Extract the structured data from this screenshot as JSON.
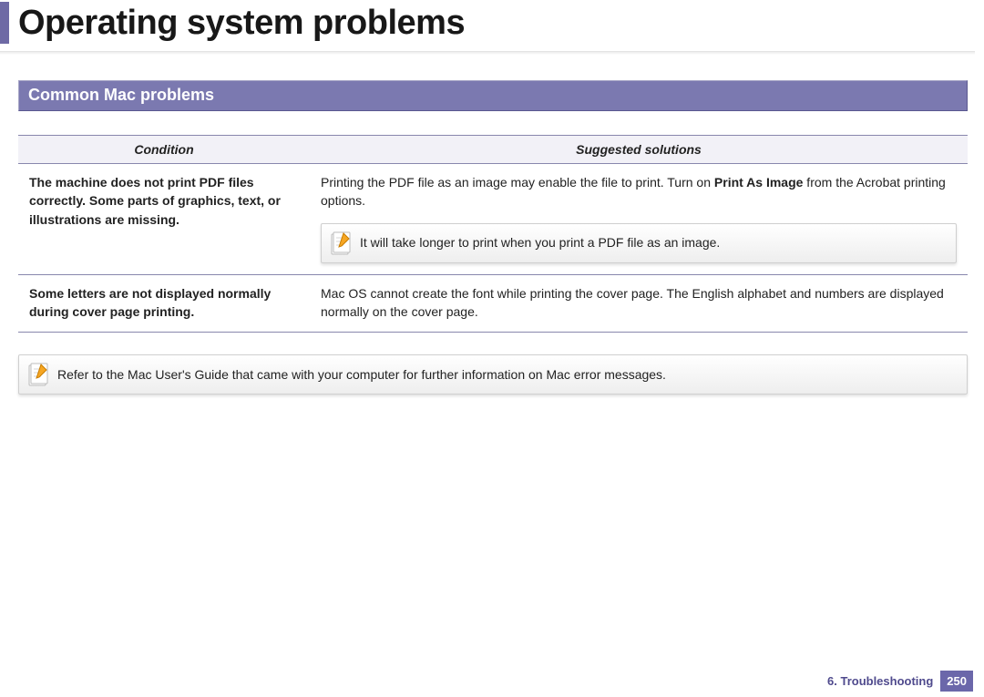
{
  "header": {
    "title": "Operating system problems"
  },
  "section": {
    "title": "Common Mac problems"
  },
  "table": {
    "headers": {
      "condition": "Condition",
      "solutions": "Suggested solutions"
    },
    "rows": [
      {
        "condition": "The machine does not print PDF files correctly. Some parts of graphics, text, or illustrations are missing.",
        "solution_pre": "Printing the PDF file as an image may enable the file to print. Turn on ",
        "solution_bold": "Print As Image",
        "solution_post": " from the Acrobat printing options.",
        "note": "It will take longer to print when you print a PDF file as an image."
      },
      {
        "condition": "Some letters are not displayed normally during cover page printing.",
        "solution": "Mac OS cannot create the font while printing the cover page. The English alphabet and numbers are displayed normally on the cover page."
      }
    ]
  },
  "footnote": "Refer to the Mac User's Guide that came with your computer for further information on Mac error messages.",
  "footer": {
    "chapter": "6.  Troubleshooting",
    "page": "250"
  }
}
